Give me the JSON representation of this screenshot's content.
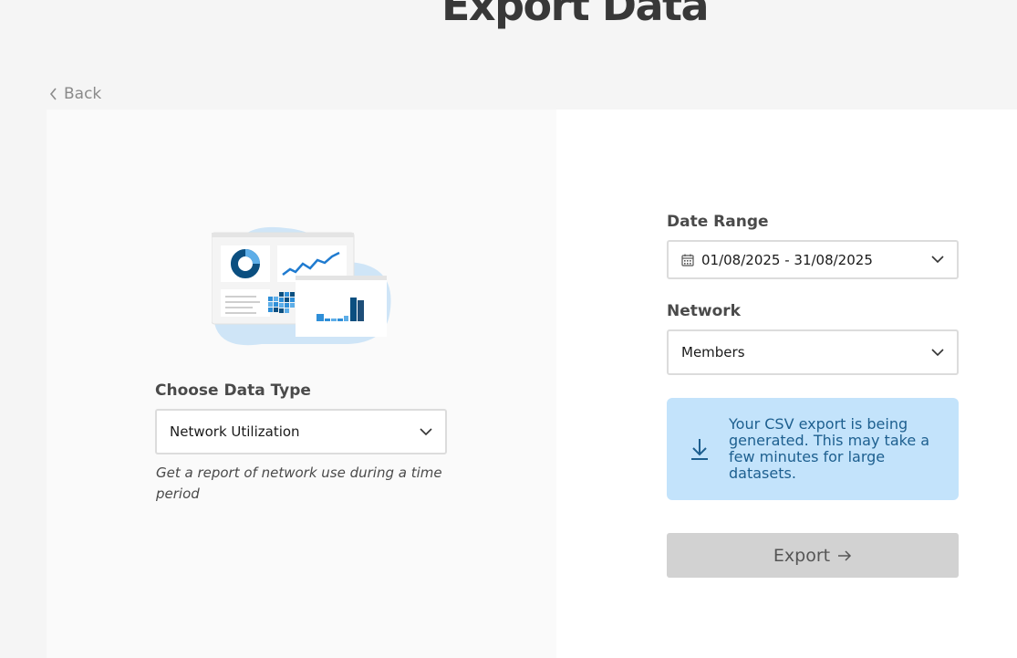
{
  "page": {
    "title": "Export Data"
  },
  "nav": {
    "back_label": "Back"
  },
  "data_type": {
    "label": "Choose Data Type",
    "selected": "Network Utilization",
    "description": "Get a report of network use during a time period"
  },
  "date_range": {
    "label": "Date Range",
    "value": "01/08/2025 - 31/08/2025"
  },
  "network": {
    "label": "Network",
    "selected": "Members"
  },
  "notice": {
    "text": "Your CSV export is being generated. This may take a few minutes for large datasets.",
    "color": "#c3e3fb"
  },
  "actions": {
    "export_label": "Export"
  },
  "colors": {
    "accent_dark": "#0b4f80",
    "accent": "#2f8fd8",
    "accent_light": "#b5dcf7",
    "button_disabled": "#d2d2d2"
  },
  "icons": [
    "chevron-left-icon",
    "chevron-down-icon",
    "calendar-icon",
    "download-icon",
    "arrow-right-icon"
  ]
}
